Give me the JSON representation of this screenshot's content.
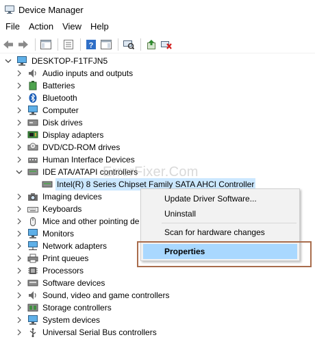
{
  "window": {
    "title": "Device Manager"
  },
  "menu": [
    "File",
    "Action",
    "View",
    "Help"
  ],
  "toolbar": {
    "buttons": [
      "back-arrow-icon",
      "forward-arrow-icon",
      "show-hide-console-tree-icon",
      "properties-icon",
      "help-icon",
      "action-pane-icon",
      "scan-hardware-icon",
      "update-driver-icon",
      "uninstall-device-icon"
    ]
  },
  "tree": {
    "root": "DESKTOP-F1TFJN5",
    "categories": [
      "Audio inputs and outputs",
      "Batteries",
      "Bluetooth",
      "Computer",
      "Disk drives",
      "Display adapters",
      "DVD/CD-ROM drives",
      "Human Interface Devices",
      "IDE ATA/ATAPI controllers",
      "Intel(R) 8 Series Chipset Family SATA AHCI Controller",
      "Imaging devices",
      "Keyboards",
      "Mice and other pointing de",
      "Monitors",
      "Network adapters",
      "Print queues",
      "Processors",
      "Software devices",
      "Sound, video and game controllers",
      "Storage controllers",
      "System devices",
      "Universal Serial Bus controllers"
    ]
  },
  "watermark": "ErrorFixer.Com",
  "context_menu": {
    "items": [
      "Update Driver Software...",
      "Uninstall",
      "Scan for hardware changes",
      "Properties"
    ]
  },
  "colors": {
    "selection": "#cce8ff",
    "menu_highlight": "#a9d8ff",
    "callout_border": "#a86c4c"
  }
}
